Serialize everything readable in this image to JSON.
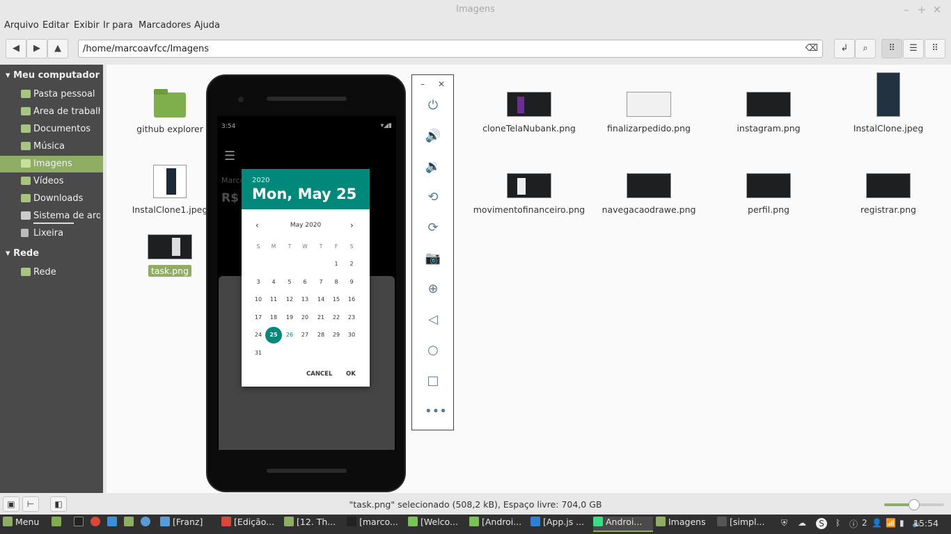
{
  "window": {
    "title": "Imagens"
  },
  "menu": [
    "Arquivo",
    "Editar",
    "Exibir",
    "Ir para",
    "Marcadores",
    "Ajuda"
  ],
  "toolbar": {
    "path": "/home/marcoavfcc/Imagens"
  },
  "sidebar": {
    "section1": "Meu computador",
    "items": [
      "Pasta pessoal",
      "Área de trabalho",
      "Documentos",
      "Música",
      "Imagens",
      "Vídeos",
      "Downloads",
      "Sistema de arquivos",
      "Lixeira"
    ],
    "selected_index": 4,
    "section2": "Rede",
    "network_items": [
      "Rede"
    ]
  },
  "files": [
    {
      "name": "github explorer",
      "type": "folder"
    },
    {
      "name": "cloneTelaNubank.png",
      "type": "image"
    },
    {
      "name": "finalizarpedido.png",
      "type": "image"
    },
    {
      "name": "instagram.png",
      "type": "image"
    },
    {
      "name": "InstalClone.jpeg",
      "type": "image"
    },
    {
      "name": "InstalClone1.jpeg",
      "type": "image"
    },
    {
      "name": "movimentofinanceiro.png",
      "type": "image"
    },
    {
      "name": "navegacaodrawe.png",
      "type": "image"
    },
    {
      "name": "perfil.png",
      "type": "image"
    },
    {
      "name": "registrar.png",
      "type": "image"
    },
    {
      "name": "task.png",
      "type": "image",
      "selected": true
    }
  ],
  "phone": {
    "time": "3:54",
    "bg_name": "Marco",
    "bg_amount": "R$",
    "picker": {
      "year": "2020",
      "date": "Mon, May 25",
      "month": "May 2020",
      "weekdays": [
        "S",
        "M",
        "T",
        "W",
        "T",
        "F",
        "S"
      ],
      "selected_day": 25,
      "today": 26,
      "cancel": "CANCEL",
      "ok": "OK"
    }
  },
  "status": {
    "text": "\"task.png\" selecionado (508,2 kB), Espaço livre: 704,0 GB",
    "zoom_fraction": 0.5
  },
  "taskbar": {
    "menu": "Menu",
    "items": [
      "[Franz]",
      "[Edição...",
      "[12. Th...",
      "[marco...",
      "[Welco...",
      "[Androi...",
      "[App.js ...",
      "Androi...",
      "Imagens",
      "[simpl..."
    ],
    "active_index": 7,
    "clock": "15:54",
    "notif_count": "2"
  },
  "colors": {
    "accent": "#8fae63",
    "teal": "#00897b",
    "sidebar": "#4a4a4a"
  }
}
